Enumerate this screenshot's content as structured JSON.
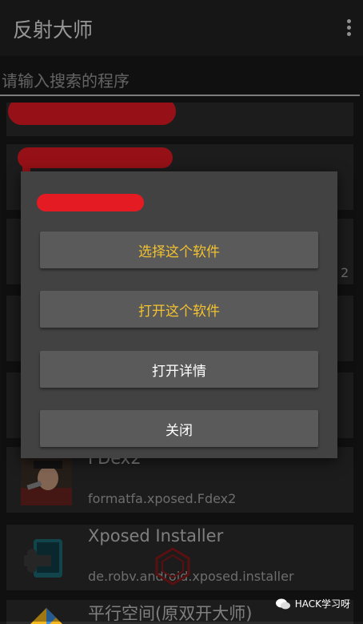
{
  "app": {
    "title": "反射大师"
  },
  "search": {
    "placeholder": "请输入搜索的程序",
    "value": ""
  },
  "apps": [
    {
      "name": "",
      "package": ""
    },
    {
      "name": "",
      "package": ""
    },
    {
      "name": "",
      "package": "2"
    },
    {
      "name": "",
      "package": ""
    },
    {
      "name": "",
      "package": ""
    },
    {
      "name": "FDex2",
      "package": "formatfa.xposed.Fdex2"
    },
    {
      "name": "Xposed Installer",
      "package": "de.robv.android.xposed.installer"
    },
    {
      "name": "平行空间(原双开大师)",
      "package": ""
    }
  ],
  "dialog": {
    "title": "",
    "buttons": {
      "select": "选择这个软件",
      "open": "打开这个软件",
      "details": "打开详情",
      "close": "关闭"
    }
  },
  "watermark": {
    "text": "HACK学习呀"
  },
  "colors": {
    "accent": "#f2c230",
    "redaction": "#e51b24",
    "dialog_bg": "#424242"
  }
}
